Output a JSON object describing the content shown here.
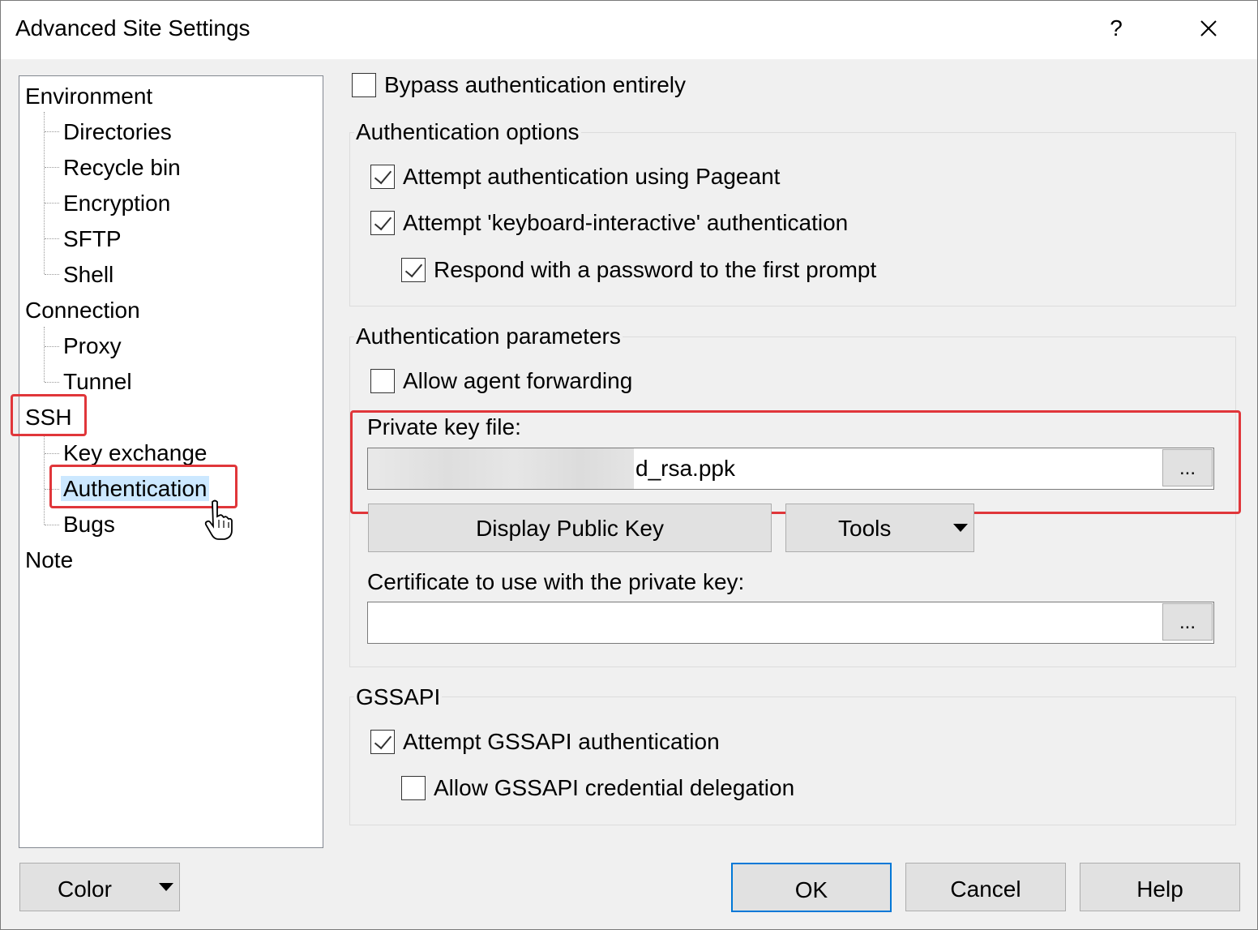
{
  "window": {
    "title": "Advanced Site Settings",
    "help_glyph": "?",
    "close_glyph": "✕"
  },
  "tree": {
    "environment": "Environment",
    "directories": "Directories",
    "recycle_bin": "Recycle bin",
    "encryption": "Encryption",
    "sftp": "SFTP",
    "shell": "Shell",
    "connection": "Connection",
    "proxy": "Proxy",
    "tunnel": "Tunnel",
    "ssh": "SSH",
    "key_exchange": "Key exchange",
    "authentication": "Authentication",
    "bugs": "Bugs",
    "note": "Note",
    "selected": "Authentication"
  },
  "auth": {
    "bypass": {
      "label": "Bypass authentication entirely",
      "checked": false
    },
    "options_group": "Authentication options",
    "pageant": {
      "label": "Attempt authentication using Pageant",
      "checked": true
    },
    "keyboard_interactive": {
      "label": "Attempt 'keyboard-interactive' authentication",
      "checked": true
    },
    "respond_password": {
      "label": "Respond with a password to the first prompt",
      "checked": true
    },
    "params_group": "Authentication parameters",
    "agent_forwarding": {
      "label": "Allow agent forwarding",
      "checked": false
    },
    "private_key_label": "Private key file:",
    "private_key_value": "d_rsa.ppk",
    "browse_label": "...",
    "display_public_key": "Display Public Key",
    "tools": "Tools",
    "certificate_label": "Certificate to use with the private key:",
    "certificate_value": "",
    "gssapi_group": "GSSAPI",
    "gssapi_attempt": {
      "label": "Attempt GSSAPI authentication",
      "checked": true
    },
    "gssapi_delegation": {
      "label": "Allow GSSAPI credential delegation",
      "checked": false
    }
  },
  "footer": {
    "color": "Color",
    "ok": "OK",
    "cancel": "Cancel",
    "help": "Help"
  },
  "colors": {
    "highlight": "#e0363a",
    "selection": "#cce8ff",
    "default_button_border": "#0078d7"
  }
}
